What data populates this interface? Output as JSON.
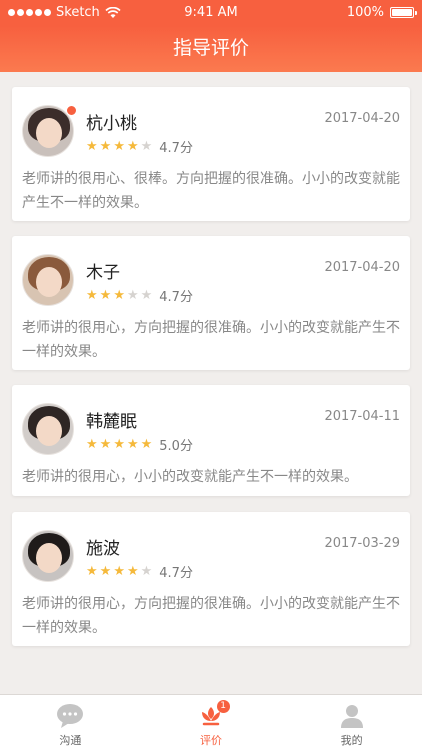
{
  "status_bar": {
    "carrier": "Sketch",
    "time": "9:41 AM",
    "battery": "100%"
  },
  "page_title": "指导评价",
  "reviews": [
    {
      "name": "杭小桃",
      "date": "2017-04-20",
      "rating": 4,
      "score": "4.7分",
      "comment": "老师讲的很用心、很棒。方向把握的很准确。小小的改变就能产生不一样的效果。",
      "has_badge": true
    },
    {
      "name": "木子",
      "date": "2017-04-20",
      "rating": 3,
      "score": "4.7分",
      "comment": "老师讲的很用心，方向把握的很准确。小小的改变就能产生不一样的效果。",
      "has_badge": false
    },
    {
      "name": "韩麓眠",
      "date": "2017-04-11",
      "rating": 5,
      "score": "5.0分",
      "comment": "老师讲的很用心，小小的改变就能产生不一样的效果。",
      "has_badge": false
    },
    {
      "name": "施波",
      "date": "2017-03-29",
      "rating": 4,
      "score": "4.7分",
      "comment": "老师讲的很用心，方向把握的很准确。小小的改变就能产生不一样的效果。",
      "has_badge": false
    }
  ],
  "tabs": [
    {
      "label": "沟通",
      "icon": "chat-icon",
      "active": false
    },
    {
      "label": "评价",
      "icon": "flower-icon",
      "active": true,
      "badge": "1"
    },
    {
      "label": "我的",
      "icon": "user-icon",
      "active": false
    }
  ],
  "colors": {
    "accent": "#f7603f",
    "star_on": "#f5b93b",
    "star_off": "#d6d3d0"
  }
}
